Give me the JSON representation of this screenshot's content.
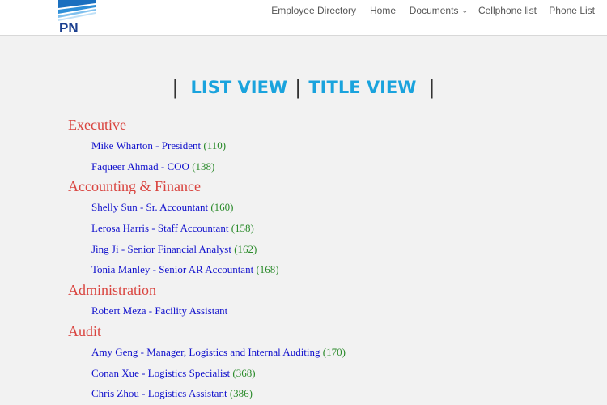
{
  "header": {
    "logo_text": "PN",
    "nav": [
      {
        "label": "Employee Directory"
      },
      {
        "label": "Home"
      },
      {
        "label": "Documents",
        "has_dropdown": true
      },
      {
        "label": "Cellphone list"
      },
      {
        "label": "Phone List"
      }
    ]
  },
  "view_switch": {
    "list_view": "LIST VIEW",
    "title_view": "TITLE VIEW",
    "separator": "|"
  },
  "colors": {
    "department": "#d9443f",
    "employee_link": "#1010cc",
    "extension": "#2a8a2a",
    "view_link": "#1aa3dd"
  },
  "departments": [
    {
      "name": "Executive",
      "employees": [
        {
          "label": "Mike Wharton - President",
          "ext": "(110)"
        },
        {
          "label": "Faqueer Ahmad - COO",
          "ext": "(138)"
        }
      ]
    },
    {
      "name": "Accounting & Finance",
      "employees": [
        {
          "label": "Shelly Sun - Sr. Accountant",
          "ext": "(160)"
        },
        {
          "label": "Lerosa Harris - Staff Accountant",
          "ext": "(158)"
        },
        {
          "label": "Jing Ji - Senior Financial Analyst",
          "ext": "(162)"
        },
        {
          "label": "Tonia Manley - Senior AR Accountant",
          "ext": "(168)"
        }
      ]
    },
    {
      "name": "Administration",
      "employees": [
        {
          "label": "Robert Meza - Facility Assistant",
          "ext": ""
        }
      ]
    },
    {
      "name": "Audit",
      "employees": [
        {
          "label": "Amy Geng - Manager, Logistics and Internal Auditing",
          "ext": "(170)"
        },
        {
          "label": "Conan Xue - Logistics Specialist",
          "ext": "(368)"
        },
        {
          "label": "Chris Zhou - Logistics Assistant",
          "ext": "(386)"
        }
      ]
    }
  ]
}
